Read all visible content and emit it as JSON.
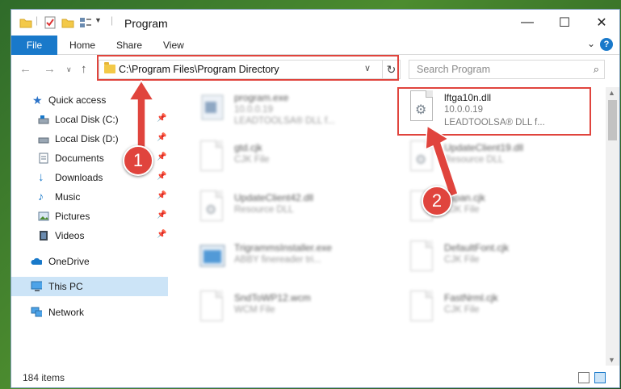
{
  "window": {
    "title": "Program",
    "controls": {
      "minimize": "—",
      "maximize": "☐",
      "close": "✕"
    }
  },
  "ribbon": {
    "file": "File",
    "tabs": [
      "Home",
      "Share",
      "View"
    ],
    "help": "?"
  },
  "nav": {
    "address": "C:\\Program Files\\Program Directory",
    "search_placeholder": "Search Program"
  },
  "sidebar": {
    "items": [
      {
        "label": "Quick access",
        "icon": "star-icon",
        "pinned": false
      },
      {
        "label": "Local Disk (C:)",
        "icon": "drive-icon",
        "pinned": true
      },
      {
        "label": "Local Disk (D:)",
        "icon": "drive-icon",
        "pinned": true
      },
      {
        "label": "Documents",
        "icon": "documents-icon",
        "pinned": true
      },
      {
        "label": "Downloads",
        "icon": "download-icon",
        "pinned": true
      },
      {
        "label": "Music",
        "icon": "music-icon",
        "pinned": true
      },
      {
        "label": "Pictures",
        "icon": "pictures-icon",
        "pinned": true
      },
      {
        "label": "Videos",
        "icon": "video-icon",
        "pinned": true
      },
      {
        "label": "OneDrive",
        "icon": "cloud-icon",
        "pinned": false
      },
      {
        "label": "This PC",
        "icon": "pc-icon",
        "pinned": false,
        "selected": true
      },
      {
        "label": "Network",
        "icon": "network-icon",
        "pinned": false
      }
    ]
  },
  "files": [
    {
      "name": "program.exe",
      "line2": "10.0.0.19",
      "line3": "LEADTOOLSA® DLL f...",
      "icon": "exe-icon",
      "blurred": true
    },
    {
      "name": "lftga10n.dll",
      "line2": "10.0.0.19",
      "line3": "LEADTOOLSA® DLL f...",
      "icon": "dll-gear-icon",
      "blurred": false,
      "highlighted": true
    },
    {
      "name": "gtd.cjk",
      "line2": "CJK File",
      "line3": "",
      "icon": "document-icon",
      "blurred": true
    },
    {
      "name": "UpdateClient19.dll",
      "line2": "Resource DLL",
      "line3": "",
      "icon": "dll-gear-icon",
      "blurred": true
    },
    {
      "name": "UpdateClient42.dll",
      "line2": "Resource DLL",
      "line3": "",
      "icon": "dll-gear-icon",
      "blurred": true
    },
    {
      "name": "Japan.cjk",
      "line2": "CJK File",
      "line3": "",
      "icon": "document-icon",
      "blurred": true
    },
    {
      "name": "TrigrammsInstaller.exe",
      "line2": "ABBY finereader tri...",
      "line3": "",
      "icon": "installer-icon",
      "blurred": true
    },
    {
      "name": "DefaultFont.cjk",
      "line2": "CJK File",
      "line3": "",
      "icon": "document-icon",
      "blurred": true
    },
    {
      "name": "SndToWP12.wcm",
      "line2": "WCM File",
      "line3": "",
      "icon": "document-icon",
      "blurred": true
    },
    {
      "name": "FastNrml.cjk",
      "line2": "CJK File",
      "line3": "",
      "icon": "document-icon",
      "blurred": true
    }
  ],
  "status": {
    "count": "184 items"
  },
  "annotations": {
    "step1": "1",
    "step2": "2",
    "color": "#e0443d"
  },
  "colors": {
    "accent": "#1979ca",
    "selection": "#cce4f7",
    "annotation": "#e0443d"
  }
}
